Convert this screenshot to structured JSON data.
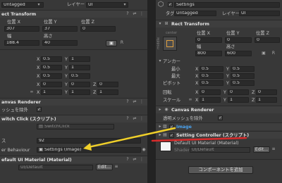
{
  "left": {
    "tag_value": "Untagged",
    "layer_label": "レイヤー",
    "layer_value": "UI",
    "rect_transform_title": "ect Transform",
    "pos_x_label": "位置 X",
    "pos_y_label": "位置 Y",
    "pos_z_label": "位置 Z",
    "pos_x": "307",
    "pos_y": "37",
    "pos_z": "0",
    "width_label": "幅",
    "height_label": "高さ",
    "width": "188.4",
    "height": "40",
    "anchor_rows": [
      {
        "xl": "X",
        "xv": "0.5",
        "yl": "Y",
        "yv": "1"
      },
      {
        "xl": "X",
        "xv": "0.5",
        "yl": "Y",
        "yv": "1"
      },
      {
        "xl": "X",
        "xv": "0.5",
        "yl": "Y",
        "yv": "0.5"
      }
    ],
    "rotation_row": {
      "xl": "X",
      "xv": "0",
      "yl": "Y",
      "yv": "0",
      "zl": "Z",
      "zv": "0"
    },
    "scale_row": {
      "xl": "X",
      "xv": "1",
      "yl": "Y",
      "yv": "1",
      "zl": "Z",
      "zv": "1"
    },
    "canvas_renderer_title": "anvas Renderer",
    "cull_label": "ッシュを除外",
    "switch_click_title": "witch Click (スクリプト)",
    "script_value": "SwitchClick",
    "field2_label": "ス",
    "field2_value": "92",
    "behaviour_label": "er Behaviour",
    "behaviour_value": "Settings (Image)",
    "material_title": "efault UI Material (Material)",
    "shader_value": "UI/Default",
    "edit_label": "Edit..."
  },
  "right": {
    "obj_name": "Settings",
    "tag_label": "タグ",
    "tag_value": "Untagged",
    "layer_label": "レイヤー",
    "layer_value": "UI",
    "rect_transform_title": "Rect Transform",
    "anchor_top": "center",
    "anchor_side": "middle",
    "pos_x_label": "位置 X",
    "pos_y_label": "位置 Y",
    "pos_z_label": "位置 Z",
    "pos_x": "0",
    "pos_y": "0",
    "pos_z": "0",
    "width_label": "幅",
    "height_label": "高さ",
    "width": "800",
    "height": "600",
    "anchor_section": "アンカー",
    "min_label": "最小",
    "max_label": "最大",
    "pivot_label": "ピボット",
    "min_x": "0.5",
    "min_y": "0.5",
    "max_x": "0.5",
    "max_y": "0.5",
    "pivot_x": "0.5",
    "pivot_y": "0.5",
    "rotation_label": "回転",
    "scale_label": "スケール",
    "rot": [
      "0",
      "0",
      "0"
    ],
    "scale": [
      "1",
      "1",
      "1"
    ],
    "axis": [
      "X",
      "Y",
      "Z"
    ],
    "canvas_renderer_title": "Canvas Renderer",
    "cull_label": "透明メッシュを除外",
    "image_title": "Image",
    "settings_controller_title": "Setting Controller (スクリプト)",
    "material_title": "Default UI Material (Material)",
    "shader_label": "Shader",
    "shader_value": "UI/Default",
    "edit_label": "Edit...",
    "add_component_label": "コンポーネントを追加"
  },
  "colors": {
    "arrow": "#f0d02a",
    "underline": "#d82b2b",
    "highlight": "#4aa3f0"
  }
}
